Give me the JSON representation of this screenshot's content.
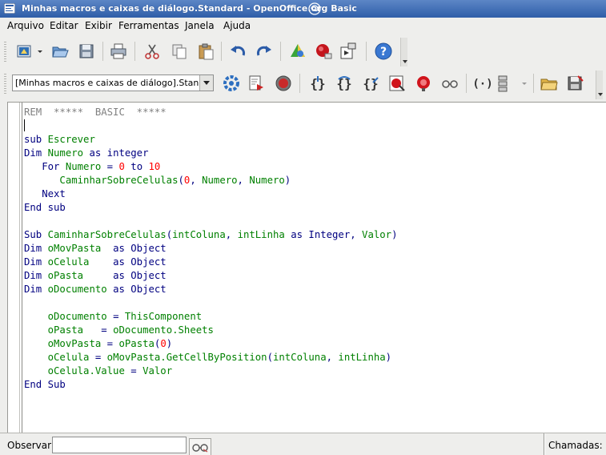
{
  "window": {
    "title": "Minhas macros e caixas de diálogo.Standard - OpenOffice.org Basic"
  },
  "menu": [
    "Arquivo",
    "Editar",
    "Exibir",
    "Ferramentas",
    "Janela",
    "Ajuda"
  ],
  "standard_toolbar": {
    "icons": [
      "new-document-icon",
      "dropdown-arrow-icon",
      "open-icon",
      "save-icon",
      "print-icon",
      "cut-icon",
      "copy-icon",
      "paste-icon",
      "undo-icon",
      "redo-icon",
      "navigator-icon",
      "macro-record-icon",
      "dialog-icon",
      "help-icon"
    ]
  },
  "macro_toolbar": {
    "library_selector": "[Minhas macros e caixas de diálogo].Standard",
    "icons": [
      "compile-icon",
      "run-basic-icon",
      "stop-macro-icon",
      "step-into-icon",
      "step-over-icon",
      "step-out-icon",
      "breakpoint-icon",
      "breakpoints-manage-icon",
      "enable-watch-icon",
      "find-parentheses-icon",
      "insert-controls-icon",
      "import-basic-icon",
      "export-basic-icon"
    ]
  },
  "editor": {
    "lines": [
      [
        {
          "t": "REM  *****  BASIC  *****",
          "c": "cm"
        }
      ],
      [],
      [
        {
          "t": "sub",
          "c": "kw"
        },
        {
          "t": " ",
          "c": ""
        },
        {
          "t": "Escrever",
          "c": "id"
        }
      ],
      [
        {
          "t": "Dim",
          "c": "kw"
        },
        {
          "t": " ",
          "c": ""
        },
        {
          "t": "Numero",
          "c": "id"
        },
        {
          "t": " as integer",
          "c": "kw"
        }
      ],
      [
        {
          "t": "   ",
          "c": ""
        },
        {
          "t": "For",
          "c": "kw"
        },
        {
          "t": " ",
          "c": ""
        },
        {
          "t": "Numero",
          "c": "id"
        },
        {
          "t": " = ",
          "c": "op"
        },
        {
          "t": "0",
          "c": "nm"
        },
        {
          "t": " to ",
          "c": "kw"
        },
        {
          "t": "10",
          "c": "nm"
        }
      ],
      [
        {
          "t": "      ",
          "c": ""
        },
        {
          "t": "CaminharSobreCelulas",
          "c": "id"
        },
        {
          "t": "(",
          "c": "op"
        },
        {
          "t": "0",
          "c": "nm"
        },
        {
          "t": ", ",
          "c": "op"
        },
        {
          "t": "Numero",
          "c": "id"
        },
        {
          "t": ", ",
          "c": "op"
        },
        {
          "t": "Numero",
          "c": "id"
        },
        {
          "t": ")",
          "c": "op"
        }
      ],
      [
        {
          "t": "   ",
          "c": ""
        },
        {
          "t": "Next",
          "c": "kw"
        }
      ],
      [
        {
          "t": "End sub",
          "c": "kw"
        }
      ],
      [],
      [
        {
          "t": "Sub",
          "c": "kw"
        },
        {
          "t": " ",
          "c": ""
        },
        {
          "t": "CaminharSobreCelulas",
          "c": "id"
        },
        {
          "t": "(",
          "c": "op"
        },
        {
          "t": "intColuna",
          "c": "id"
        },
        {
          "t": ", ",
          "c": "op"
        },
        {
          "t": "intLinha",
          "c": "id"
        },
        {
          "t": " as Integer",
          "c": "kw"
        },
        {
          "t": ", ",
          "c": "op"
        },
        {
          "t": "Valor",
          "c": "id"
        },
        {
          "t": ")",
          "c": "op"
        }
      ],
      [
        {
          "t": "Dim",
          "c": "kw"
        },
        {
          "t": " ",
          "c": ""
        },
        {
          "t": "oMovPasta",
          "c": "id"
        },
        {
          "t": "  as Object",
          "c": "kw"
        }
      ],
      [
        {
          "t": "Dim",
          "c": "kw"
        },
        {
          "t": " ",
          "c": ""
        },
        {
          "t": "oCelula",
          "c": "id"
        },
        {
          "t": "    as Object",
          "c": "kw"
        }
      ],
      [
        {
          "t": "Dim",
          "c": "kw"
        },
        {
          "t": " ",
          "c": ""
        },
        {
          "t": "oPasta",
          "c": "id"
        },
        {
          "t": "     as Object",
          "c": "kw"
        }
      ],
      [
        {
          "t": "Dim",
          "c": "kw"
        },
        {
          "t": " ",
          "c": ""
        },
        {
          "t": "oDocumento",
          "c": "id"
        },
        {
          "t": " as Object",
          "c": "kw"
        }
      ],
      [],
      [
        {
          "t": "    ",
          "c": ""
        },
        {
          "t": "oDocumento",
          "c": "id"
        },
        {
          "t": " = ",
          "c": "op"
        },
        {
          "t": "ThisComponent",
          "c": "id"
        }
      ],
      [
        {
          "t": "    ",
          "c": ""
        },
        {
          "t": "oPasta",
          "c": "id"
        },
        {
          "t": "   = ",
          "c": "op"
        },
        {
          "t": "oDocumento.Sheets",
          "c": "id"
        }
      ],
      [
        {
          "t": "    ",
          "c": ""
        },
        {
          "t": "oMovPasta",
          "c": "id"
        },
        {
          "t": " = ",
          "c": "op"
        },
        {
          "t": "oPasta",
          "c": "id"
        },
        {
          "t": "(",
          "c": "op"
        },
        {
          "t": "0",
          "c": "nm"
        },
        {
          "t": ")",
          "c": "op"
        }
      ],
      [
        {
          "t": "    ",
          "c": ""
        },
        {
          "t": "oCelula",
          "c": "id"
        },
        {
          "t": " = ",
          "c": "op"
        },
        {
          "t": "oMovPasta.GetCellByPosition",
          "c": "id"
        },
        {
          "t": "(",
          "c": "op"
        },
        {
          "t": "intColuna",
          "c": "id"
        },
        {
          "t": ", ",
          "c": "op"
        },
        {
          "t": "intLinha",
          "c": "id"
        },
        {
          "t": ")",
          "c": "op"
        }
      ],
      [
        {
          "t": "    ",
          "c": ""
        },
        {
          "t": "oCelula.Value",
          "c": "id"
        },
        {
          "t": " = ",
          "c": "op"
        },
        {
          "t": "Valor",
          "c": "id"
        }
      ],
      [
        {
          "t": "End Sub",
          "c": "kw"
        }
      ]
    ]
  },
  "watch": {
    "label": "Observar:",
    "value": ""
  },
  "calls": {
    "label": "Chamadas:"
  },
  "colors": {
    "keyword": "#000080",
    "identifier": "#008000",
    "number": "#ff0000",
    "comment": "#808080"
  }
}
